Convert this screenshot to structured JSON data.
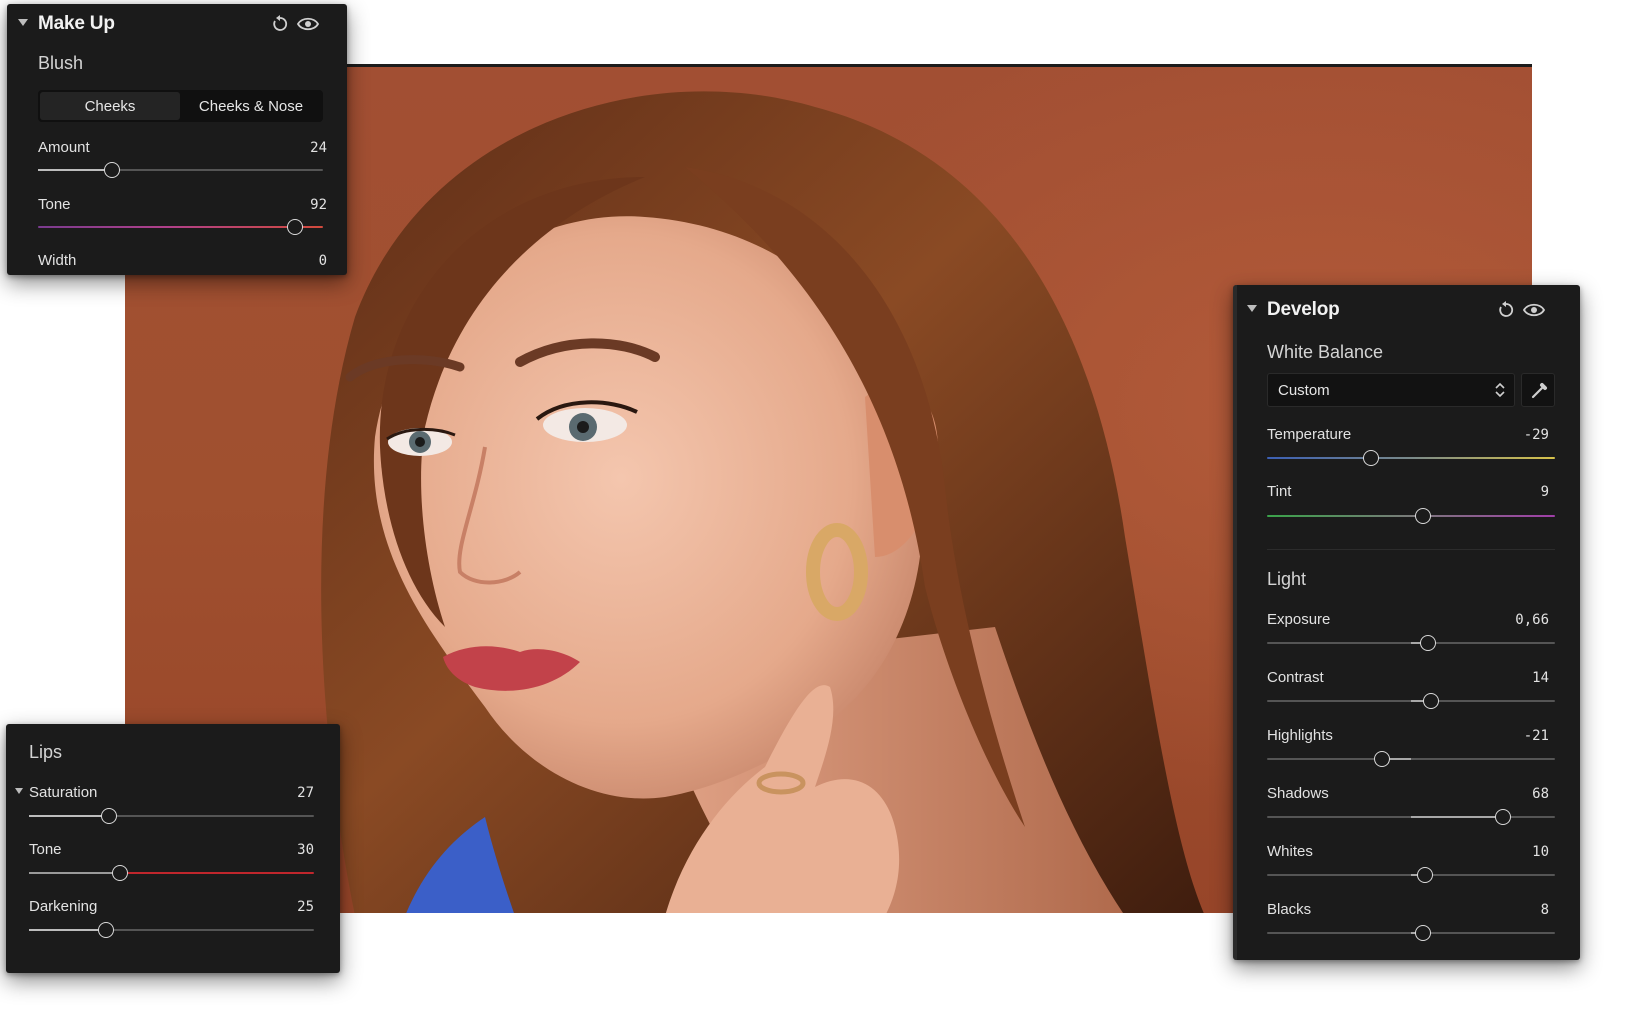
{
  "makeup_panel": {
    "title": "Make Up",
    "section": "Blush",
    "tabs": [
      {
        "label": "Cheeks",
        "active": true
      },
      {
        "label": "Cheeks & Nose",
        "active": false
      }
    ],
    "sliders": [
      {
        "label": "Amount",
        "value": "24",
        "fraction": 0.26
      },
      {
        "label": "Tone",
        "value": "92",
        "fraction": 0.9
      },
      {
        "label": "Width",
        "value": "0",
        "fraction": 0.0
      }
    ]
  },
  "lips_panel": {
    "section": "Lips",
    "sliders": [
      {
        "label": "Saturation",
        "value": "27",
        "fraction": 0.28
      },
      {
        "label": "Tone",
        "value": "30",
        "fraction": 0.32
      },
      {
        "label": "Darkening",
        "value": "25",
        "fraction": 0.27
      }
    ]
  },
  "develop_panel": {
    "title": "Develop",
    "white_balance": {
      "section": "White Balance",
      "preset": "Custom",
      "sliders": [
        {
          "label": "Temperature",
          "value": "-29",
          "fraction": 0.36
        },
        {
          "label": "Tint",
          "value": "9",
          "fraction": 0.54
        }
      ]
    },
    "light": {
      "section": "Light",
      "sliders": [
        {
          "label": "Exposure",
          "value": "0,66",
          "fraction": 0.56
        },
        {
          "label": "Contrast",
          "value": "14",
          "fraction": 0.57
        },
        {
          "label": "Highlights",
          "value": "-21",
          "fraction": 0.4
        },
        {
          "label": "Shadows",
          "value": "68",
          "fraction": 0.82
        },
        {
          "label": "Whites",
          "value": "10",
          "fraction": 0.55
        },
        {
          "label": "Blacks",
          "value": "8",
          "fraction": 0.54
        }
      ]
    }
  },
  "colors": {
    "panel_bg": "#1b1b1b",
    "backdrop": "#a0502f",
    "blush_tone_start": "#7a3b8f",
    "blush_tone_end": "#d24a3c",
    "lips_tone": "#c0262c",
    "temp_start": "#3b5fb4",
    "temp_end": "#d7c24a",
    "tint_start": "#3aa34a",
    "tint_end": "#a03ea8"
  }
}
